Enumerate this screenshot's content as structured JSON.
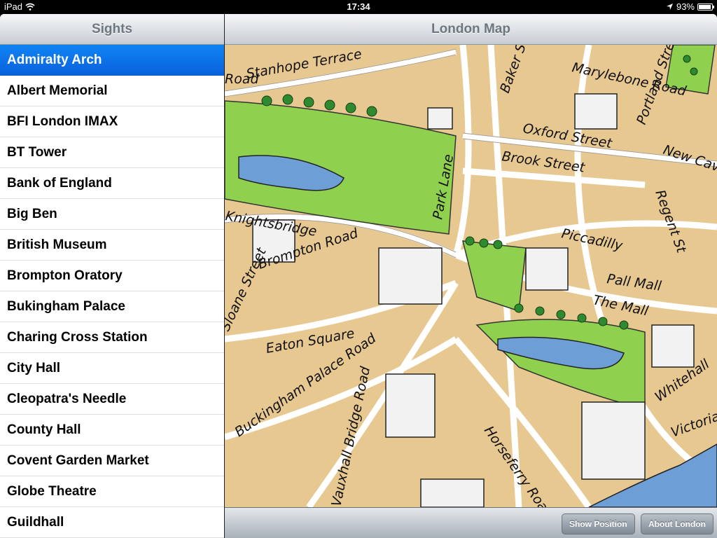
{
  "status_bar": {
    "device": "iPad",
    "time": "17:34",
    "battery": "93%",
    "battery_level": 0.93
  },
  "master": {
    "title": "Sights",
    "items": [
      "Admiralty Arch",
      "Albert Memorial",
      "BFI London IMAX",
      "BT Tower",
      "Bank of England",
      "Big Ben",
      "British Museum",
      "Brompton Oratory",
      "Bukingham Palace",
      "Charing Cross Station",
      "City Hall",
      "Cleopatra's Needle",
      "County Hall",
      "Covent Garden Market",
      "Globe Theatre",
      "Guildhall"
    ],
    "selected_index": 0
  },
  "detail": {
    "title": "London Map",
    "map_labels": [
      "Stanhope Terrace",
      "Road",
      "Baker St",
      "Marylebone Road",
      "Oxford Street",
      "Brook Street",
      "Portland Street",
      "New Cavendish",
      "Regent St",
      "Piccadilly",
      "Pall Mall",
      "The Mall",
      "Park Lane",
      "Knightsbridge",
      "Brompton Road",
      "Sloane Street",
      "Eaton Square",
      "Buckingham Palace Road",
      "Vauxhall Bridge Road",
      "Horseferry Road",
      "Whitehall",
      "Victoria embankment"
    ],
    "toolbar": {
      "show_position": "Show Position",
      "about_london": "About London"
    }
  },
  "colors": {
    "accent": "#0a6ee8",
    "map_background": "#e8c891",
    "park": "#8fd14f",
    "water": "#6e9ed6"
  }
}
